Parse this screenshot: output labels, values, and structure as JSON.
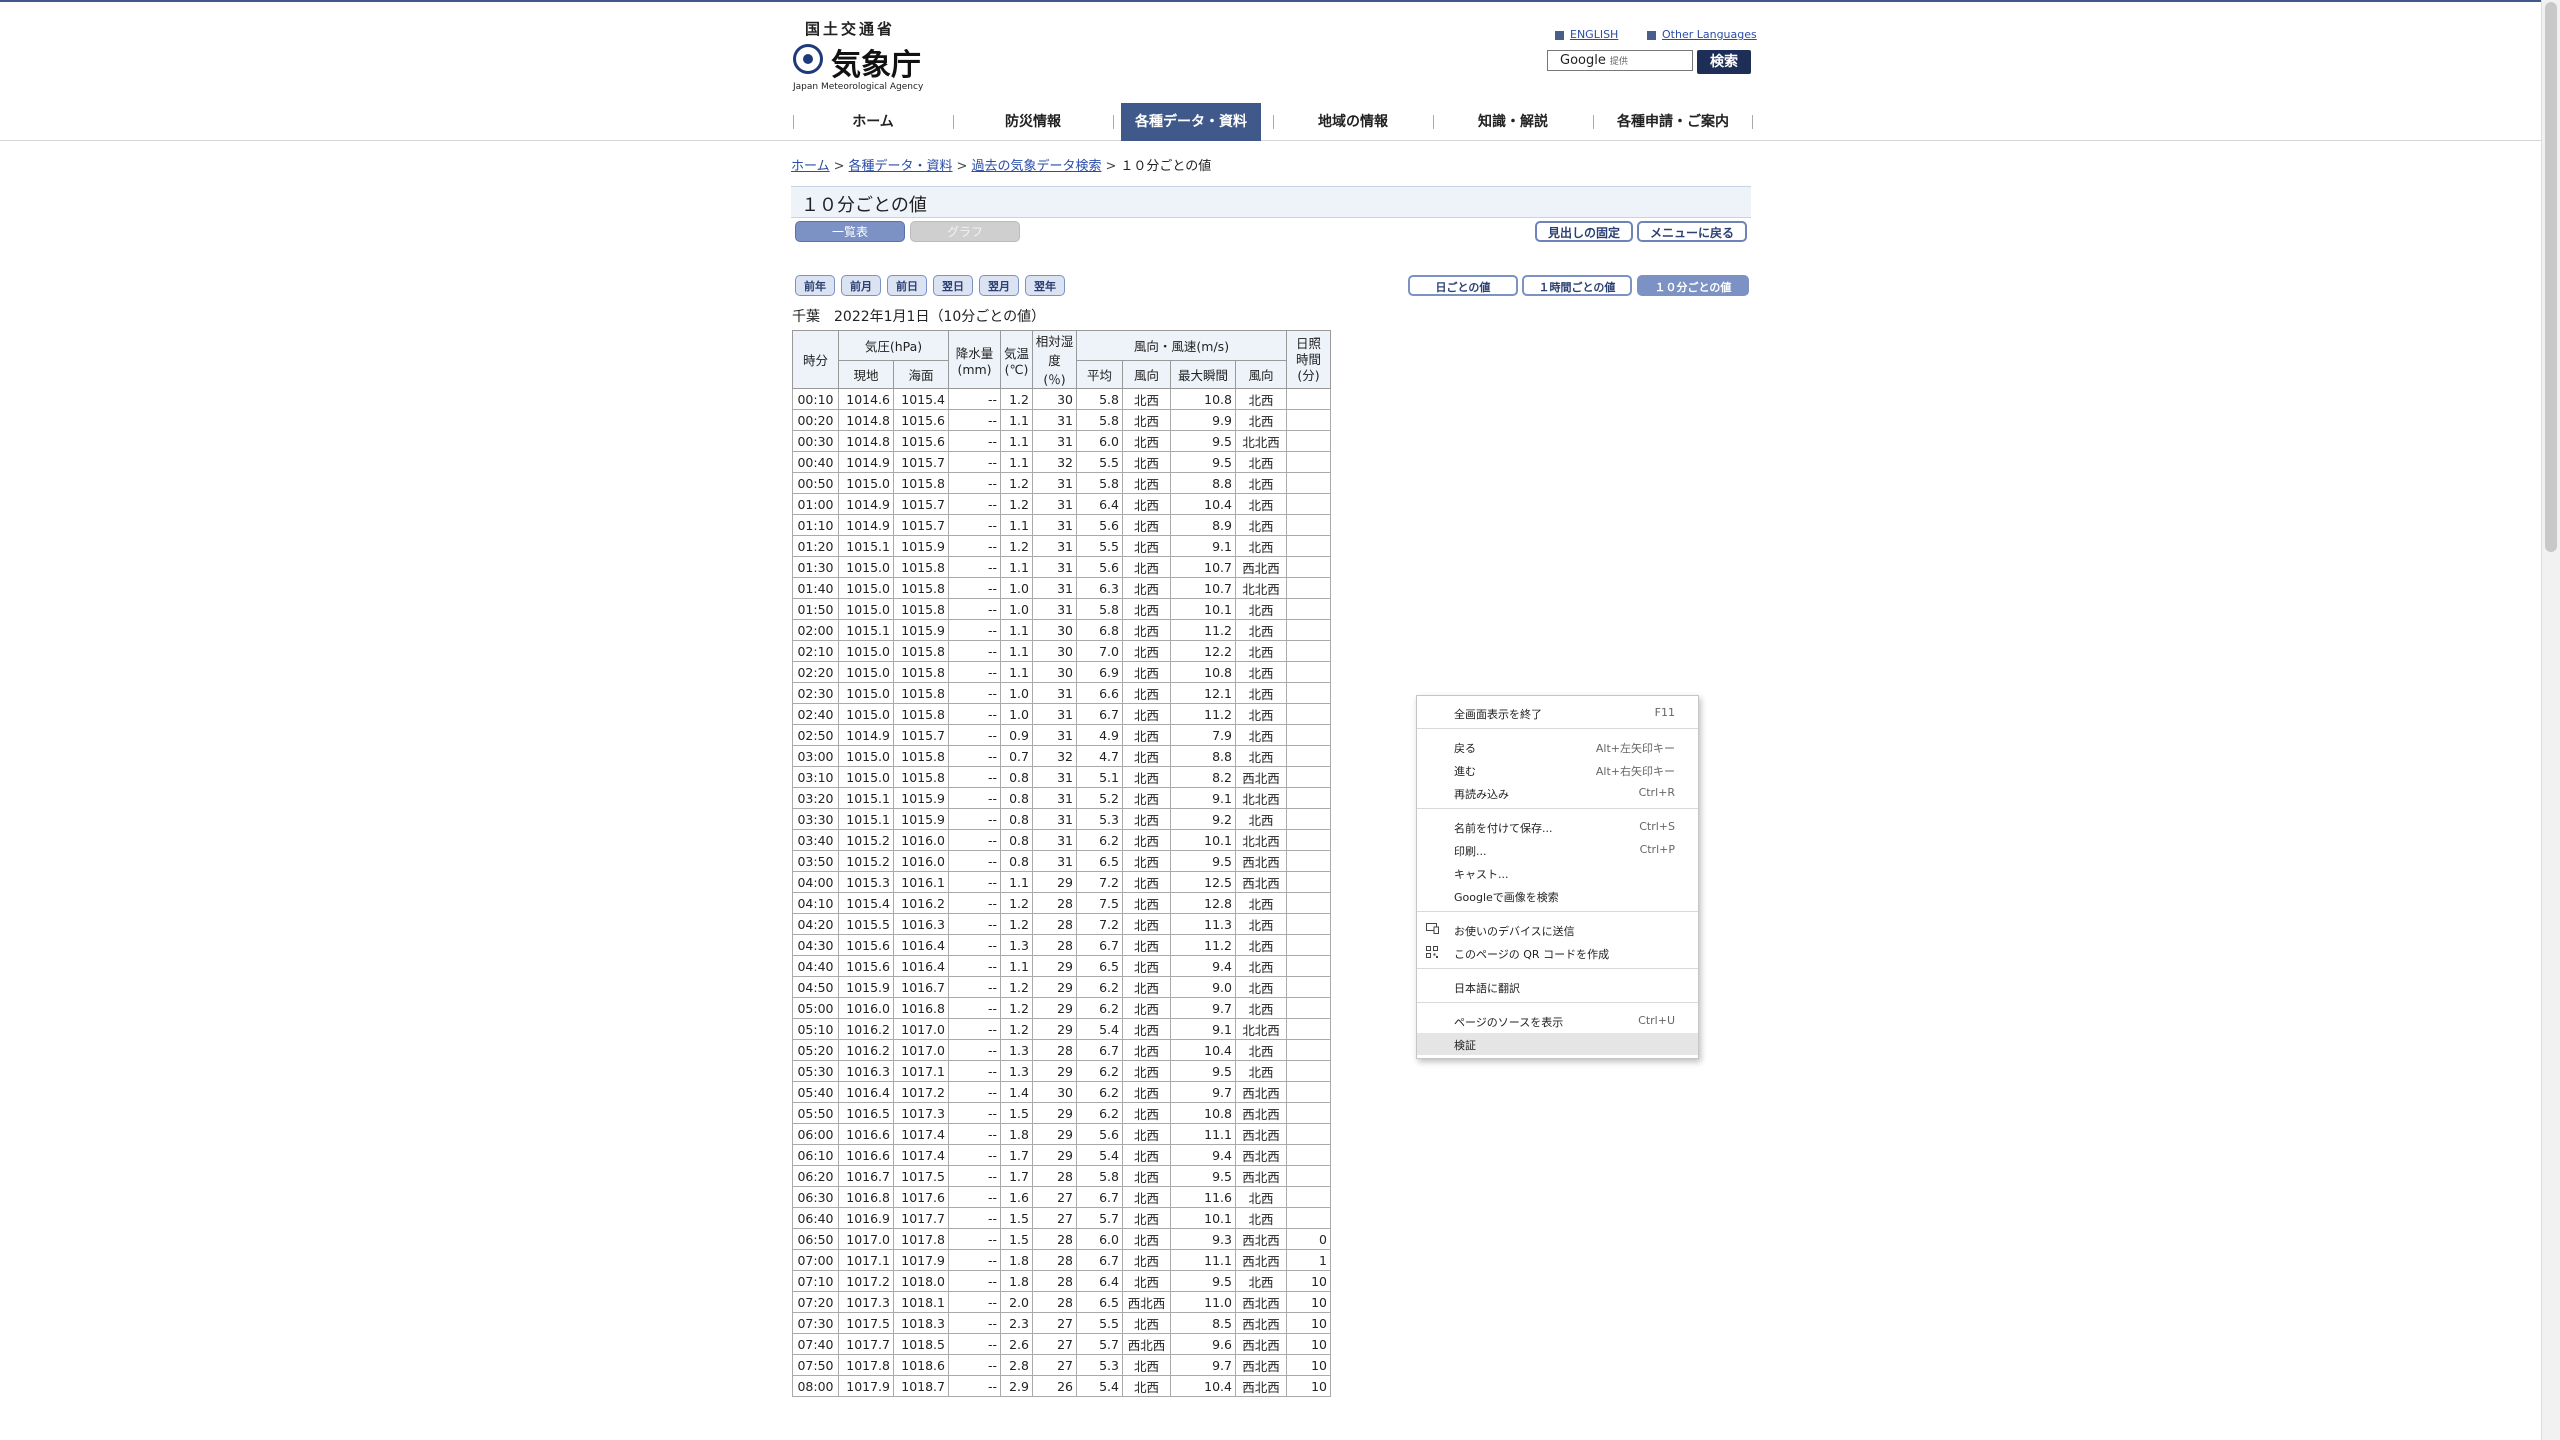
{
  "header": {
    "ministry": "国土交通省",
    "agency_ja": "気象庁",
    "agency_en": "Japan Meteorological Agency",
    "english_link": "ENGLISH",
    "other_languages_link": "Other Languages",
    "search_brand": "Google",
    "search_sub": "提供",
    "search_button": "検索"
  },
  "nav": [
    "ホーム",
    "防災情報",
    "各種データ・資料",
    "地域の情報",
    "知識・解説",
    "各種申請・ご案内"
  ],
  "breadcrumb": [
    "ホーム",
    "各種データ・資料",
    "過去の気象データ検索",
    "１０分ごとの値"
  ],
  "page_title": "１０分ごとの値",
  "buttons": {
    "list": "一覧表",
    "graph": "グラフ",
    "fix_header": "見出しの固定",
    "back_menu": "メニューに戻る",
    "prev_year": "前年",
    "prev_month": "前月",
    "prev_day": "前日",
    "next_day": "翌日",
    "next_month": "翌月",
    "next_year": "翌年",
    "daily": "日ごとの値",
    "hourly": "１時間ごとの値",
    "tenmin": "１０分ごとの値"
  },
  "caption": "千葉　2022年1月1日（10分ごとの値）",
  "table": {
    "h_time": "時分",
    "h_pressure": "気圧(hPa)",
    "h_precip": "降水量\n(mm)",
    "h_temp": "気温\n(℃)",
    "h_humidity": "相対湿度\n(％)",
    "h_wind": "風向・風速(m/s)",
    "h_sunshine": "日照\n時間\n(分)",
    "h_local": "現地",
    "h_sea": "海面",
    "h_avg": "平均",
    "h_dir": "風向",
    "h_max": "最大瞬間",
    "h_dir2": "風向",
    "rows": [
      [
        "00:10",
        "1014.6",
        "1015.4",
        "--",
        "1.2",
        "30",
        "5.8",
        "北西",
        "10.8",
        "北西",
        ""
      ],
      [
        "00:20",
        "1014.8",
        "1015.6",
        "--",
        "1.1",
        "31",
        "5.8",
        "北西",
        "9.9",
        "北西",
        ""
      ],
      [
        "00:30",
        "1014.8",
        "1015.6",
        "--",
        "1.1",
        "31",
        "6.0",
        "北西",
        "9.5",
        "北北西",
        ""
      ],
      [
        "00:40",
        "1014.9",
        "1015.7",
        "--",
        "1.1",
        "32",
        "5.5",
        "北西",
        "9.5",
        "北西",
        ""
      ],
      [
        "00:50",
        "1015.0",
        "1015.8",
        "--",
        "1.2",
        "31",
        "5.8",
        "北西",
        "8.8",
        "北西",
        ""
      ],
      [
        "01:00",
        "1014.9",
        "1015.7",
        "--",
        "1.2",
        "31",
        "6.4",
        "北西",
        "10.4",
        "北西",
        ""
      ],
      [
        "01:10",
        "1014.9",
        "1015.7",
        "--",
        "1.1",
        "31",
        "5.6",
        "北西",
        "8.9",
        "北西",
        ""
      ],
      [
        "01:20",
        "1015.1",
        "1015.9",
        "--",
        "1.2",
        "31",
        "5.5",
        "北西",
        "9.1",
        "北西",
        ""
      ],
      [
        "01:30",
        "1015.0",
        "1015.8",
        "--",
        "1.1",
        "31",
        "5.6",
        "北西",
        "10.7",
        "西北西",
        ""
      ],
      [
        "01:40",
        "1015.0",
        "1015.8",
        "--",
        "1.0",
        "31",
        "6.3",
        "北西",
        "10.7",
        "北北西",
        ""
      ],
      [
        "01:50",
        "1015.0",
        "1015.8",
        "--",
        "1.0",
        "31",
        "5.8",
        "北西",
        "10.1",
        "北西",
        ""
      ],
      [
        "02:00",
        "1015.1",
        "1015.9",
        "--",
        "1.1",
        "30",
        "6.8",
        "北西",
        "11.2",
        "北西",
        ""
      ],
      [
        "02:10",
        "1015.0",
        "1015.8",
        "--",
        "1.1",
        "30",
        "7.0",
        "北西",
        "12.2",
        "北西",
        ""
      ],
      [
        "02:20",
        "1015.0",
        "1015.8",
        "--",
        "1.1",
        "30",
        "6.9",
        "北西",
        "10.8",
        "北西",
        ""
      ],
      [
        "02:30",
        "1015.0",
        "1015.8",
        "--",
        "1.0",
        "31",
        "6.6",
        "北西",
        "12.1",
        "北西",
        ""
      ],
      [
        "02:40",
        "1015.0",
        "1015.8",
        "--",
        "1.0",
        "31",
        "6.7",
        "北西",
        "11.2",
        "北西",
        ""
      ],
      [
        "02:50",
        "1014.9",
        "1015.7",
        "--",
        "0.9",
        "31",
        "4.9",
        "北西",
        "7.9",
        "北西",
        ""
      ],
      [
        "03:00",
        "1015.0",
        "1015.8",
        "--",
        "0.7",
        "32",
        "4.7",
        "北西",
        "8.8",
        "北西",
        ""
      ],
      [
        "03:10",
        "1015.0",
        "1015.8",
        "--",
        "0.8",
        "31",
        "5.1",
        "北西",
        "8.2",
        "西北西",
        ""
      ],
      [
        "03:20",
        "1015.1",
        "1015.9",
        "--",
        "0.8",
        "31",
        "5.2",
        "北西",
        "9.1",
        "北北西",
        ""
      ],
      [
        "03:30",
        "1015.1",
        "1015.9",
        "--",
        "0.8",
        "31",
        "5.3",
        "北西",
        "9.2",
        "北西",
        ""
      ],
      [
        "03:40",
        "1015.2",
        "1016.0",
        "--",
        "0.8",
        "31",
        "6.2",
        "北西",
        "10.1",
        "北北西",
        ""
      ],
      [
        "03:50",
        "1015.2",
        "1016.0",
        "--",
        "0.8",
        "31",
        "6.5",
        "北西",
        "9.5",
        "西北西",
        ""
      ],
      [
        "04:00",
        "1015.3",
        "1016.1",
        "--",
        "1.1",
        "29",
        "7.2",
        "北西",
        "12.5",
        "西北西",
        ""
      ],
      [
        "04:10",
        "1015.4",
        "1016.2",
        "--",
        "1.2",
        "28",
        "7.5",
        "北西",
        "12.8",
        "北西",
        ""
      ],
      [
        "04:20",
        "1015.5",
        "1016.3",
        "--",
        "1.2",
        "28",
        "7.2",
        "北西",
        "11.3",
        "北西",
        ""
      ],
      [
        "04:30",
        "1015.6",
        "1016.4",
        "--",
        "1.3",
        "28",
        "6.7",
        "北西",
        "11.2",
        "北西",
        ""
      ],
      [
        "04:40",
        "1015.6",
        "1016.4",
        "--",
        "1.1",
        "29",
        "6.5",
        "北西",
        "9.4",
        "北西",
        ""
      ],
      [
        "04:50",
        "1015.9",
        "1016.7",
        "--",
        "1.2",
        "29",
        "6.2",
        "北西",
        "9.0",
        "北西",
        ""
      ],
      [
        "05:00",
        "1016.0",
        "1016.8",
        "--",
        "1.2",
        "29",
        "6.2",
        "北西",
        "9.7",
        "北西",
        ""
      ],
      [
        "05:10",
        "1016.2",
        "1017.0",
        "--",
        "1.2",
        "29",
        "5.4",
        "北西",
        "9.1",
        "北北西",
        ""
      ],
      [
        "05:20",
        "1016.2",
        "1017.0",
        "--",
        "1.3",
        "28",
        "6.7",
        "北西",
        "10.4",
        "北西",
        ""
      ],
      [
        "05:30",
        "1016.3",
        "1017.1",
        "--",
        "1.3",
        "29",
        "6.2",
        "北西",
        "9.5",
        "北西",
        ""
      ],
      [
        "05:40",
        "1016.4",
        "1017.2",
        "--",
        "1.4",
        "30",
        "6.2",
        "北西",
        "9.7",
        "西北西",
        ""
      ],
      [
        "05:50",
        "1016.5",
        "1017.3",
        "--",
        "1.5",
        "29",
        "6.2",
        "北西",
        "10.8",
        "西北西",
        ""
      ],
      [
        "06:00",
        "1016.6",
        "1017.4",
        "--",
        "1.8",
        "29",
        "5.6",
        "北西",
        "11.1",
        "西北西",
        ""
      ],
      [
        "06:10",
        "1016.6",
        "1017.4",
        "--",
        "1.7",
        "29",
        "5.4",
        "北西",
        "9.4",
        "西北西",
        ""
      ],
      [
        "06:20",
        "1016.7",
        "1017.5",
        "--",
        "1.7",
        "28",
        "5.8",
        "北西",
        "9.5",
        "西北西",
        ""
      ],
      [
        "06:30",
        "1016.8",
        "1017.6",
        "--",
        "1.6",
        "27",
        "6.7",
        "北西",
        "11.6",
        "北西",
        ""
      ],
      [
        "06:40",
        "1016.9",
        "1017.7",
        "--",
        "1.5",
        "27",
        "5.7",
        "北西",
        "10.1",
        "北西",
        ""
      ],
      [
        "06:50",
        "1017.0",
        "1017.8",
        "--",
        "1.5",
        "28",
        "6.0",
        "北西",
        "9.3",
        "西北西",
        "0"
      ],
      [
        "07:00",
        "1017.1",
        "1017.9",
        "--",
        "1.8",
        "28",
        "6.7",
        "北西",
        "11.1",
        "西北西",
        "1"
      ],
      [
        "07:10",
        "1017.2",
        "1018.0",
        "--",
        "1.8",
        "28",
        "6.4",
        "北西",
        "9.5",
        "北西",
        "10"
      ],
      [
        "07:20",
        "1017.3",
        "1018.1",
        "--",
        "2.0",
        "28",
        "6.5",
        "西北西",
        "11.0",
        "西北西",
        "10"
      ],
      [
        "07:30",
        "1017.5",
        "1018.3",
        "--",
        "2.3",
        "27",
        "5.5",
        "北西",
        "8.5",
        "西北西",
        "10"
      ],
      [
        "07:40",
        "1017.7",
        "1018.5",
        "--",
        "2.6",
        "27",
        "5.7",
        "西北西",
        "9.6",
        "西北西",
        "10"
      ],
      [
        "07:50",
        "1017.8",
        "1018.6",
        "--",
        "2.8",
        "27",
        "5.3",
        "北西",
        "9.7",
        "西北西",
        "10"
      ],
      [
        "08:00",
        "1017.9",
        "1018.7",
        "--",
        "2.9",
        "26",
        "5.4",
        "北西",
        "10.4",
        "西北西",
        "10"
      ]
    ]
  },
  "context_menu": {
    "items": [
      {
        "label": "全画面表示を終了",
        "shortcut": "F11"
      },
      {
        "label": "戻る",
        "shortcut": "Alt+左矢印キー"
      },
      {
        "label": "進む",
        "shortcut": "Alt+右矢印キー"
      },
      {
        "label": "再読み込み",
        "shortcut": "Ctrl+R"
      },
      {
        "label": "名前を付けて保存...",
        "shortcut": "Ctrl+S"
      },
      {
        "label": "印刷...",
        "shortcut": "Ctrl+P"
      },
      {
        "label": "キャスト...",
        "shortcut": ""
      },
      {
        "label": "Googleで画像を検索",
        "shortcut": ""
      },
      {
        "label": "お使いのデバイスに送信",
        "shortcut": "",
        "icon": "device-icon"
      },
      {
        "label": "このページの QR コードを作成",
        "shortcut": "",
        "icon": "qr-code-icon"
      },
      {
        "label": "日本語に翻訳",
        "shortcut": ""
      },
      {
        "label": "ページのソースを表示",
        "shortcut": "Ctrl+U"
      },
      {
        "label": "検証",
        "shortcut": ""
      }
    ]
  }
}
